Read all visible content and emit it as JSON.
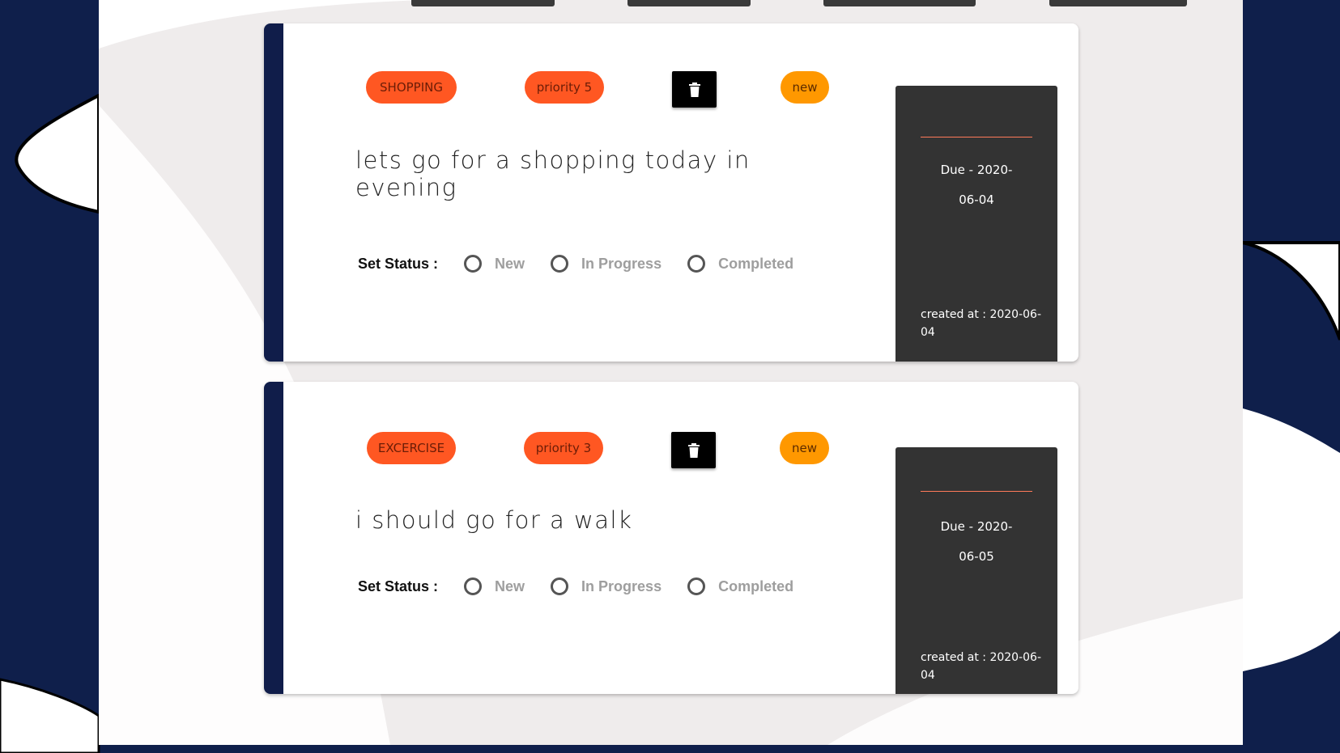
{
  "theme": {
    "background": "#0f1f4b",
    "panel": "#efecec",
    "accent_orange": "#ff5722",
    "accent_amber": "#ff9800",
    "sidebar_dark": "#333333",
    "stripe": "#101d4a"
  },
  "status_label": "Set Status :",
  "status_options": [
    "New",
    "In Progress",
    "Completed"
  ],
  "tasks": [
    {
      "category": "SHOPPING",
      "priority": "priority 5",
      "state": "new",
      "text": "lets go for a shopping today in evening",
      "due_line1": "Due - 2020-",
      "due_line2": "06-04",
      "created_line1": "created at : 2020-06-",
      "created_line2": "04",
      "delete_icon": "trash-icon"
    },
    {
      "category": "EXCERCISE",
      "priority": "priority 3",
      "state": "new",
      "text": "i should go for a walk",
      "due_line1": "Due - 2020-",
      "due_line2": "06-05",
      "created_line1": "created at : 2020-06-",
      "created_line2": "04",
      "delete_icon": "trash-icon"
    }
  ]
}
